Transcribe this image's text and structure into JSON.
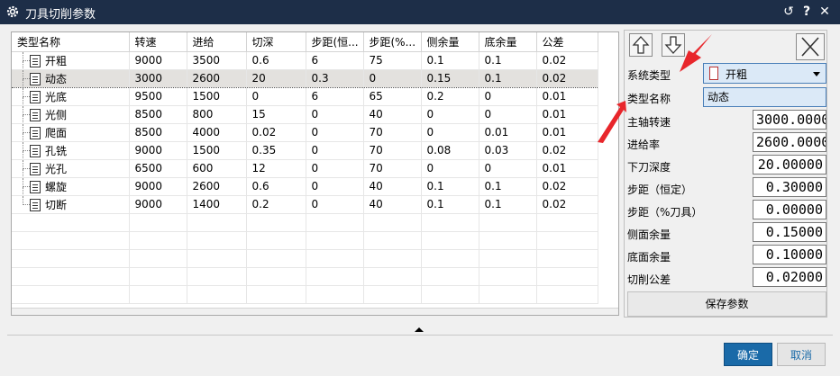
{
  "window": {
    "title": "刀具切削参数"
  },
  "table": {
    "columns": [
      "类型名称",
      "转速",
      "进给",
      "切深",
      "步距(恒...",
      "步距(%...",
      "侧余量",
      "底余量",
      "公差"
    ],
    "rows": [
      {
        "name": "开粗",
        "speed": "9000",
        "feed": "3500",
        "depth": "0.6",
        "step_const": "6",
        "step_pct": "75",
        "side": "0.1",
        "floor": "0.1",
        "tol": "0.02",
        "selected": false
      },
      {
        "name": "动态",
        "speed": "3000",
        "feed": "2600",
        "depth": "20",
        "step_const": "0.3",
        "step_pct": "0",
        "side": "0.15",
        "floor": "0.1",
        "tol": "0.02",
        "selected": true
      },
      {
        "name": "光底",
        "speed": "9500",
        "feed": "1500",
        "depth": "0",
        "step_const": "6",
        "step_pct": "65",
        "side": "0.2",
        "floor": "0",
        "tol": "0.01",
        "selected": false
      },
      {
        "name": "光侧",
        "speed": "8500",
        "feed": "800",
        "depth": "15",
        "step_const": "0",
        "step_pct": "40",
        "side": "0",
        "floor": "0",
        "tol": "0.01",
        "selected": false
      },
      {
        "name": "爬面",
        "speed": "8500",
        "feed": "4000",
        "depth": "0.02",
        "step_const": "0",
        "step_pct": "70",
        "side": "0",
        "floor": "0.01",
        "tol": "0.01",
        "selected": false
      },
      {
        "name": "孔铣",
        "speed": "9000",
        "feed": "1500",
        "depth": "0.35",
        "step_const": "0",
        "step_pct": "70",
        "side": "0.08",
        "floor": "0.03",
        "tol": "0.02",
        "selected": false
      },
      {
        "name": "光孔",
        "speed": "6500",
        "feed": "600",
        "depth": "12",
        "step_const": "0",
        "step_pct": "70",
        "side": "0",
        "floor": "0",
        "tol": "0.01",
        "selected": false
      },
      {
        "name": "螺旋",
        "speed": "9000",
        "feed": "2600",
        "depth": "0.6",
        "step_const": "0",
        "step_pct": "40",
        "side": "0.1",
        "floor": "0.1",
        "tol": "0.02",
        "selected": false
      },
      {
        "name": "切断",
        "speed": "9000",
        "feed": "1400",
        "depth": "0.2",
        "step_const": "0",
        "step_pct": "40",
        "side": "0.1",
        "floor": "0.1",
        "tol": "0.02",
        "selected": false
      }
    ]
  },
  "panel": {
    "system_type_label": "系统类型",
    "system_type_value": "开粗",
    "type_name_label": "类型名称",
    "type_name_value": "动态",
    "spindle_label": "主轴转速",
    "spindle_value": "3000.0000",
    "feed_label": "进给率",
    "feed_value": "2600.0000",
    "depth_label": "下刀深度",
    "depth_value": "20.00000",
    "step_const_label": "步距（恒定）",
    "step_const_value": "0.30000",
    "step_pct_label": "步距（%刀具）",
    "step_pct_value": "0.00000",
    "side_label": "侧面余量",
    "side_value": "0.15000",
    "floor_label": "底面余量",
    "floor_value": "0.10000",
    "tol_label": "切削公差",
    "tol_value": "0.02000",
    "save_label": "保存参数"
  },
  "footer": {
    "ok_label": "确定",
    "cancel_label": "取消"
  },
  "colors": {
    "titlebar": "#1d2e48",
    "ok": "#1a6aa8",
    "annotation": "#e8262b",
    "field_focus": "#dbe9f7"
  }
}
